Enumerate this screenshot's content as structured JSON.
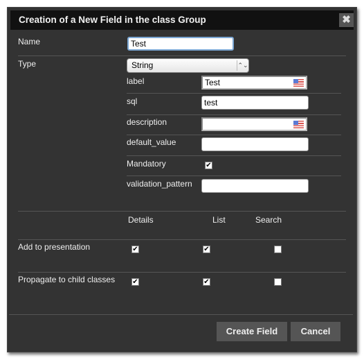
{
  "dialog": {
    "title": "Creation of a New Field in the class Group",
    "close_icon": "close-icon"
  },
  "form": {
    "name_label": "Name",
    "name_value": "Test",
    "type_label": "Type",
    "type_value": "String",
    "sub_fields": {
      "label": {
        "label": "label",
        "value": "Test",
        "icon": "us-flag-icon"
      },
      "sql": {
        "label": "sql",
        "value": "test"
      },
      "description": {
        "label": "description",
        "value": "",
        "icon": "us-flag-icon"
      },
      "default_value": {
        "label": "default_value",
        "value": ""
      },
      "mandatory": {
        "label": "Mandatory",
        "checked": true
      },
      "validation_pattern": {
        "label": "validation_pattern",
        "value": ""
      }
    }
  },
  "grid": {
    "columns": [
      "Details",
      "List",
      "Search"
    ],
    "rows": [
      {
        "label": "Add to presentation",
        "checks": [
          true,
          true,
          false
        ]
      },
      {
        "label": "Propagate to child classes",
        "checks": [
          true,
          true,
          false
        ]
      }
    ]
  },
  "footer": {
    "create_label": "Create Field",
    "cancel_label": "Cancel"
  }
}
